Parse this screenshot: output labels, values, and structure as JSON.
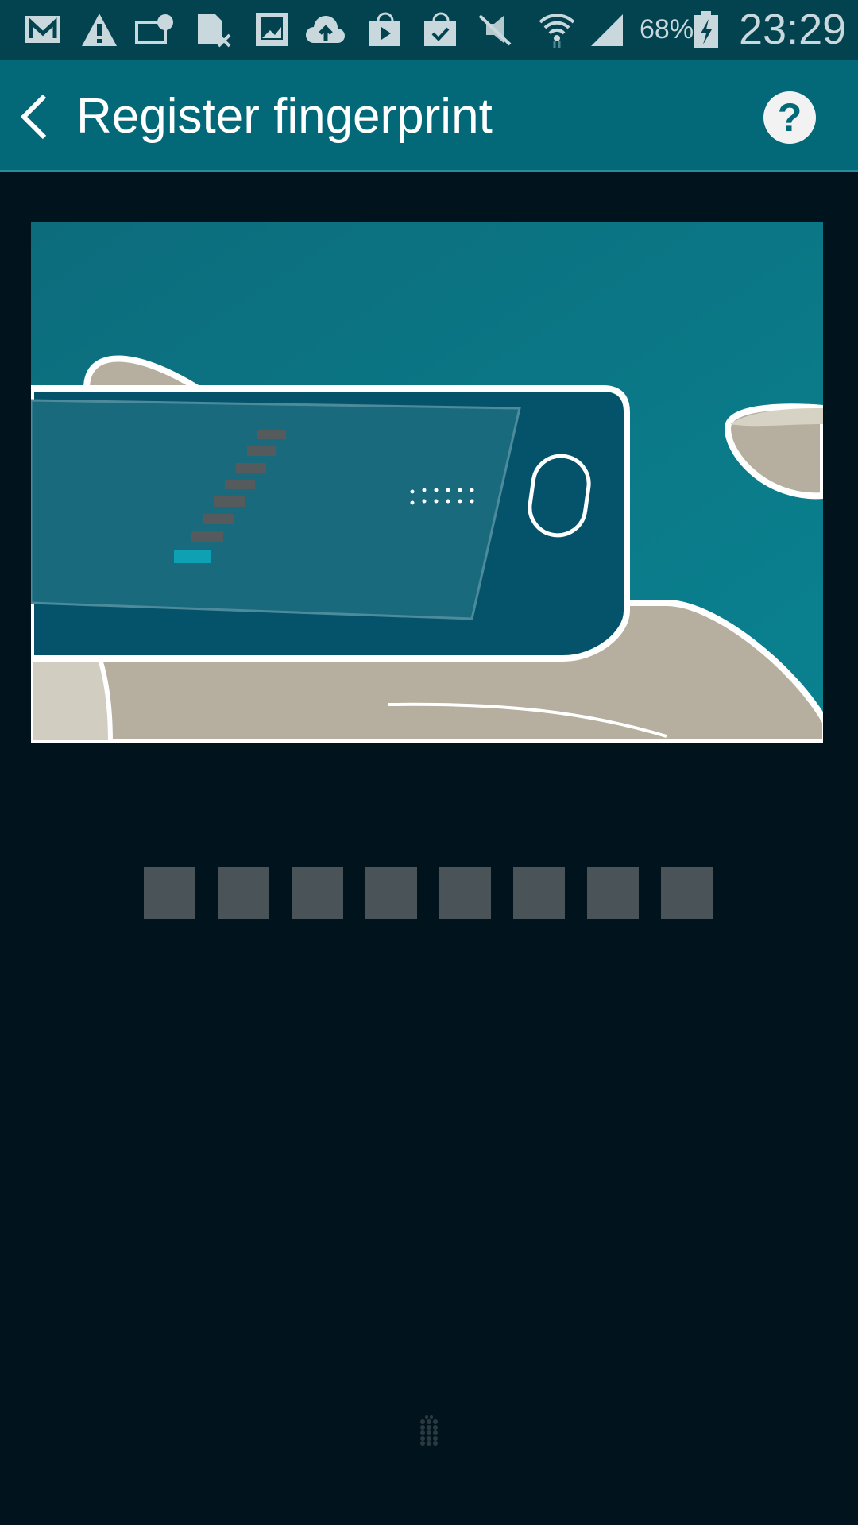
{
  "status_bar": {
    "icons": [
      "gmail-icon",
      "warning-icon",
      "nfc-icon",
      "sim-error-icon",
      "gallery-icon",
      "cloud-upload-icon",
      "play-store-icon",
      "store-check-icon",
      "mute-vibrate-icon",
      "wifi-icon",
      "signal-icon",
      "battery-charging-icon"
    ],
    "battery": "68%",
    "time": "23:29"
  },
  "app_bar": {
    "title": "Register fingerprint",
    "back_icon": "chevron-left-icon",
    "help_icon": "help-icon"
  },
  "progress": {
    "total_steps": 8,
    "completed_steps": 0,
    "colors": {
      "pending": "#4a5458",
      "accent": "#0ea1b4"
    }
  }
}
